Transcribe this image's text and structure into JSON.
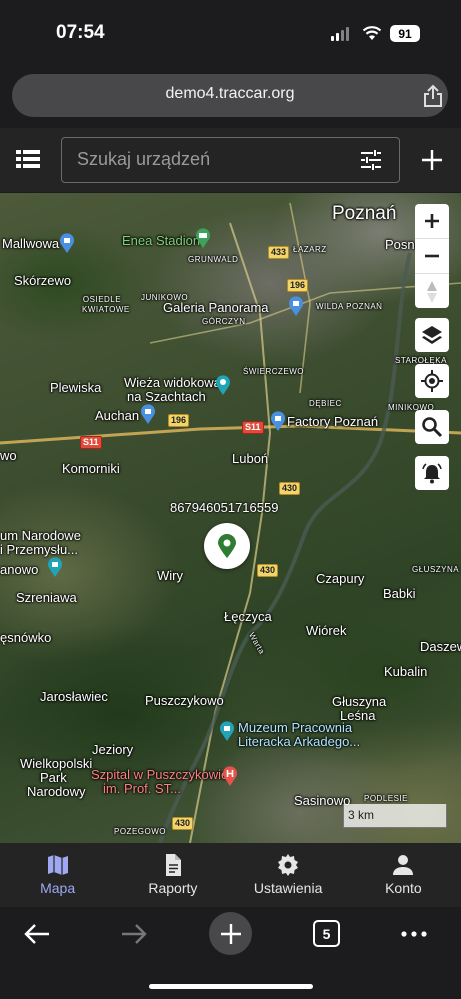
{
  "status_bar": {
    "time": "07:54",
    "battery": "91"
  },
  "browser": {
    "url": "demo4.traccar.org",
    "tabs_count": "5"
  },
  "toolbar": {
    "search_placeholder": "Szukaj urządzeń"
  },
  "map": {
    "labels": {
      "poznan": "Poznań",
      "mallwowa": "Mallwowa",
      "enea_stadion": "Enea Stadion",
      "grunwald": "GRUNWALD",
      "lazarz": "ŁAZARZ",
      "posna": "Posna",
      "skorzewo": "Skórzewo",
      "junikowo": "JUNIKOWO",
      "galeria_panorama": "Galeria Panorama",
      "gorczyn": "GÓRCZYN",
      "wilda_poznan": "WILDA POZNAŃ",
      "osiedle_kwiatowe": "OSIEDLE KWIATOWE",
      "swierczewo": "ŚWIERCZEWO",
      "staroleka": "STAROŁĘKA",
      "plewiska": "Plewiska",
      "wieza_widokowa": "Wieża widokowa",
      "na_szachtach": "na Szachtach",
      "debiec": "DĘBIEC",
      "minikowo": "MINIKOWO",
      "auchan": "Auchan",
      "factory_poznan": "Factory Poznań",
      "komorniki": "Komorniki",
      "lubon": "Luboń",
      "wo": "wo",
      "um_narodowe": "um Narodowe",
      "i_przemyslu": "i Przemysłu...",
      "anowo": "anowo",
      "szreniawa": "Szreniawa",
      "wiry": "Wiry",
      "czapury": "Czapury",
      "glusz": "GŁUSZYNA",
      "babki": "Babki",
      "esnowko": "ęsnówko",
      "leczyca": "Łęczyca",
      "warta": "Warta",
      "wiorek": "Wiórek",
      "daszew": "Daszew",
      "kubalin": "Kubalin",
      "jaroslawiec": "Jarosławiec",
      "puszczykowo": "Puszczykowo",
      "gluszyna": "Głuszyna",
      "lesna": "Leśna",
      "muzeum_pracownia": "Muzeum Pracownia",
      "literacka": "Literacka Arkadego...",
      "jeziory": "Jeziory",
      "wielkopolski_park": "Wielkopolski",
      "park": "Park",
      "narodowy": "Narodowy",
      "szpital": "Szpital w Puszczykowie",
      "szpital2": "im. Prof. ST...",
      "sasinowo": "Sasinowo",
      "podlesie": "PODLESIE",
      "pozegowo": "POZEGOWO"
    },
    "shields": {
      "r433": "433",
      "r196a": "196",
      "r196b": "196",
      "s11a": "S11",
      "s11b": "S11",
      "r430a": "430",
      "r430b": "430",
      "r430c": "430"
    },
    "device_name": "867946051716559",
    "scale": "3 km"
  },
  "nav": {
    "map": "Mapa",
    "reports": "Raporty",
    "settings": "Ustawienia",
    "account": "Konto"
  },
  "colors": {
    "accent": "#9fa8f0",
    "marker": "#2e7d32",
    "toolbar": "#242424"
  }
}
